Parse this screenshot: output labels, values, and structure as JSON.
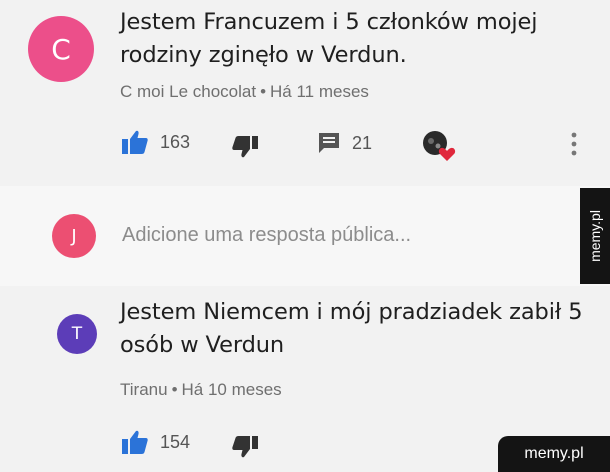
{
  "comments": [
    {
      "avatar_letter": "C",
      "avatar_color": "#ec4f8a",
      "text": "Jestem Francuzem i 5 członków mojej rodziny zginęło w Verdun.",
      "author": "C moi Le chocolat",
      "time": "Há 11 meses",
      "likes": "163",
      "replies": "21"
    },
    {
      "avatar_letter": "T",
      "avatar_color": "#5c3db8",
      "text": "Jestem Niemcem i mój pradziadek zabił 5 osób w Verdun",
      "author": "Tiranu",
      "time": "Há 10 meses",
      "likes": "154"
    }
  ],
  "reply_box": {
    "avatar_letter": "J",
    "avatar_color": "#ec4f72",
    "placeholder": "Adicione uma resposta pública..."
  },
  "watermark": {
    "side": "memy.pl",
    "corner": "memy.pl"
  },
  "icons": {
    "like": "thumbs-up-icon",
    "dislike": "thumbs-down-icon",
    "reply": "comment-icon",
    "heart": "creator-heart-icon",
    "more": "more-vert-icon"
  },
  "colors": {
    "like_blue": "#2b73d8",
    "heart_red": "#e0283c"
  }
}
